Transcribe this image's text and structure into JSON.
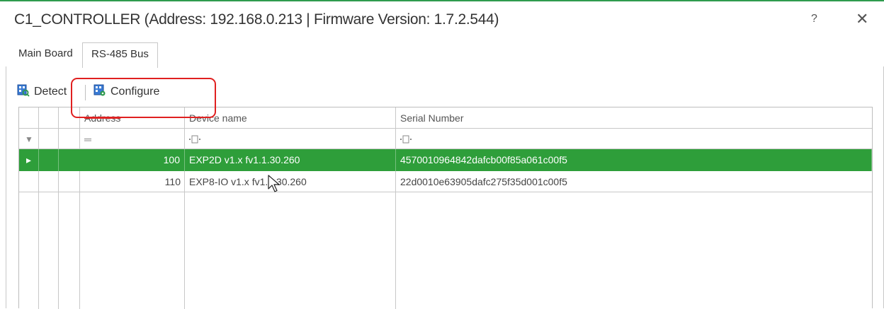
{
  "window": {
    "title": "C1_CONTROLLER (Address: 192.168.0.213 | Firmware Version: 1.7.2.544)",
    "help_label": "?",
    "close_label": "✕"
  },
  "tabs": [
    {
      "label": "Main Board",
      "active": false
    },
    {
      "label": "RS-485 Bus",
      "active": true
    }
  ],
  "toolbar": {
    "detect_label": "Detect",
    "configure_label": "Configure"
  },
  "grid": {
    "columns": [
      "Address",
      "Device name",
      "Serial Number"
    ],
    "filter": {
      "address": "═",
      "device_name_icon": "filter-icon",
      "serial_icon": "filter-icon",
      "row_indicator": "▼"
    },
    "rows": [
      {
        "indicator": "▸",
        "address": "100",
        "device_name": "EXP2D v1.x fv1.1.30.260",
        "serial": "4570010964842dafcb00f85a061c00f5",
        "selected": true
      },
      {
        "indicator": "",
        "address": "110",
        "device_name": "EXP8-IO v1.x fv1.0.30.260",
        "serial": "22d0010e63905dafc275f35d001c00f5",
        "selected": false
      }
    ]
  },
  "colors": {
    "accent": "#2e9b4d",
    "selected_row": "#2e9e3a",
    "highlight_box": "#e02020"
  }
}
